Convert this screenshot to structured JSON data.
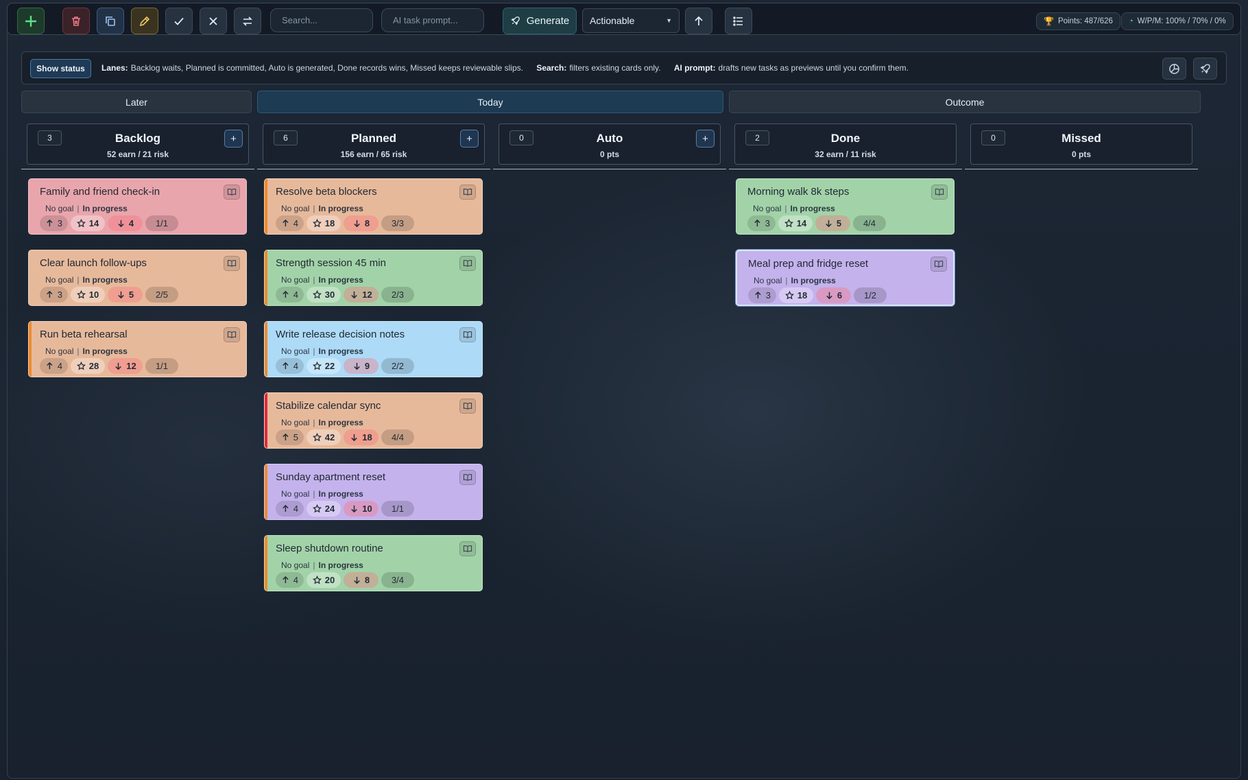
{
  "toolbar": {
    "search_placeholder": "Search...",
    "ai_placeholder": "AI task prompt...",
    "generate_label": "Generate",
    "filter_value": "Actionable",
    "points": "Points: 487/626",
    "wpm": "W/P/M: 100% / 70% / 0%",
    "colors": {
      "add": "#5fe08a",
      "delete": "#ef7a8a",
      "edit": "#f0c860"
    }
  },
  "info": {
    "status_button": "Show status",
    "lanes_label": "Lanes:",
    "lanes_text": "Backlog waits, Planned is committed, Auto is generated, Done records wins, Missed keeps reviewable slips.",
    "search_label": "Search:",
    "search_text": "filters existing cards only.",
    "ai_label": "AI prompt:",
    "ai_text": "drafts new tasks as previews until you confirm them."
  },
  "groups": {
    "later": "Later",
    "today": "Today",
    "outcome": "Outcome"
  },
  "columns": [
    {
      "count": "3",
      "title": "Backlog",
      "sub": "52 earn / 21 risk",
      "add": "+"
    },
    {
      "count": "6",
      "title": "Planned",
      "sub": "156 earn / 65 risk",
      "add": "+"
    },
    {
      "count": "0",
      "title": "Auto",
      "sub": "0 pts",
      "add": "+"
    },
    {
      "count": "2",
      "title": "Done",
      "sub": "32 earn / 11 risk"
    },
    {
      "count": "0",
      "title": "Missed",
      "sub": "0 pts"
    }
  ],
  "card_meta": {
    "goal": "No goal",
    "sep": "|",
    "state": "In progress"
  },
  "cards": {
    "backlog": [
      {
        "title": "Family and friend check-in",
        "up": "3",
        "star": "14",
        "down": "4",
        "prog": "1/1",
        "color": "#e9a5ac"
      },
      {
        "title": "Clear launch follow-ups",
        "up": "3",
        "star": "10",
        "down": "5",
        "prog": "2/5",
        "color": "#e7b99b"
      },
      {
        "title": "Run beta rehearsal",
        "up": "4",
        "star": "28",
        "down": "12",
        "prog": "1/1",
        "color": "#e7b99b",
        "accent": "#f08a2c"
      }
    ],
    "planned": [
      {
        "title": "Resolve beta blockers",
        "up": "4",
        "star": "18",
        "down": "8",
        "prog": "3/3",
        "color": "#e7b99b",
        "accent": "#f08a2c"
      },
      {
        "title": "Strength session 45 min",
        "up": "4",
        "star": "30",
        "down": "12",
        "prog": "2/3",
        "color": "#a2d3a8",
        "accent": "#f08a2c"
      },
      {
        "title": "Write release decision notes",
        "up": "4",
        "star": "22",
        "down": "9",
        "prog": "2/2",
        "color": "#addaf6",
        "accent": "#f08a2c"
      },
      {
        "title": "Stabilize calendar sync",
        "up": "5",
        "star": "42",
        "down": "18",
        "prog": "4/4",
        "color": "#e7b99b",
        "accent": "#e0283c"
      },
      {
        "title": "Sunday apartment reset",
        "up": "4",
        "star": "24",
        "down": "10",
        "prog": "1/1",
        "color": "#c4b2ec",
        "accent": "#f08a2c"
      },
      {
        "title": "Sleep shutdown routine",
        "up": "4",
        "star": "20",
        "down": "8",
        "prog": "3/4",
        "color": "#a2d3a8",
        "accent": "#f08a2c"
      }
    ],
    "done": [
      {
        "title": "Morning walk 8k steps",
        "up": "3",
        "star": "14",
        "down": "5",
        "prog": "4/4",
        "color": "#a2d3a8"
      },
      {
        "title": "Meal prep and fridge reset",
        "up": "3",
        "star": "18",
        "down": "6",
        "prog": "1/2",
        "color": "#c4b2ec"
      }
    ]
  }
}
